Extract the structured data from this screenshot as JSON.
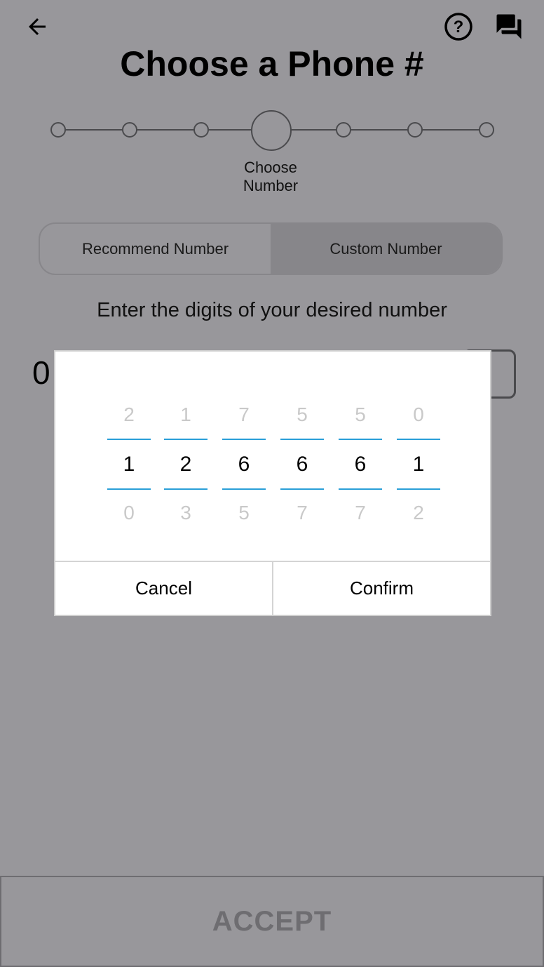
{
  "header": {
    "back_icon": "arrow-left-icon",
    "help_icon": "question-circle-icon",
    "chat_icon": "chat-bubbles-icon",
    "title": "Choose a Phone #"
  },
  "stepper": {
    "total_steps": 7,
    "current_step": 4,
    "current_label_line1": "Choose",
    "current_label_line2": "Number"
  },
  "tabs": [
    {
      "label": "Recommend Number",
      "selected": false
    },
    {
      "label": "Custom Number",
      "selected": true
    }
  ],
  "instruction": "Enter the digits of your desired number",
  "number_input": {
    "prefix": "0"
  },
  "picker": {
    "columns": [
      {
        "above": "2",
        "selected": "1",
        "below": "0"
      },
      {
        "above": "1",
        "selected": "2",
        "below": "3"
      },
      {
        "above": "7",
        "selected": "6",
        "below": "5"
      },
      {
        "above": "5",
        "selected": "6",
        "below": "7"
      },
      {
        "above": "5",
        "selected": "6",
        "below": "7"
      },
      {
        "above": "0",
        "selected": "1",
        "below": "2"
      }
    ],
    "cancel_label": "Cancel",
    "confirm_label": "Confirm"
  },
  "accept_label": "ACCEPT",
  "colors": {
    "background": "#98979b",
    "picker_accent": "#2a9fd8",
    "disabled_text": "#6e6d71"
  }
}
